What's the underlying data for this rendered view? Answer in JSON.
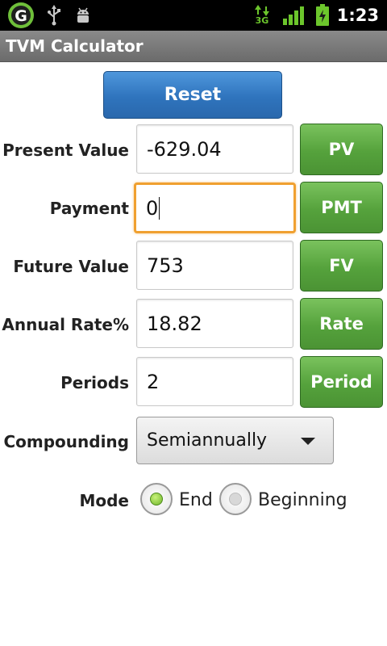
{
  "status_bar": {
    "time": "1:23",
    "network_label": "3G",
    "icons": [
      "app-logo-icon",
      "usb-icon",
      "android-debug-icon",
      "data-arrows-icon",
      "signal-icon",
      "battery-charging-icon"
    ]
  },
  "app": {
    "title": "TVM Calculator"
  },
  "reset_label": "Reset",
  "rows": [
    {
      "label": "Present Value",
      "value": "-629.04",
      "button": "PV"
    },
    {
      "label": "Payment",
      "value": "0",
      "button": "PMT"
    },
    {
      "label": "Future Value",
      "value": "753",
      "button": "FV"
    },
    {
      "label": "Annual Rate%",
      "value": "18.82",
      "button": "Rate"
    },
    {
      "label": "Periods",
      "value": "2",
      "button": "Period"
    }
  ],
  "compounding": {
    "label": "Compounding",
    "selected": "Semiannually"
  },
  "mode": {
    "label": "Mode",
    "options": [
      "End",
      "Beginning"
    ],
    "selected": "End"
  },
  "colors": {
    "reset_blue": "#3a83cc",
    "action_green": "#5aa83f",
    "focus_orange": "#f0a030"
  }
}
